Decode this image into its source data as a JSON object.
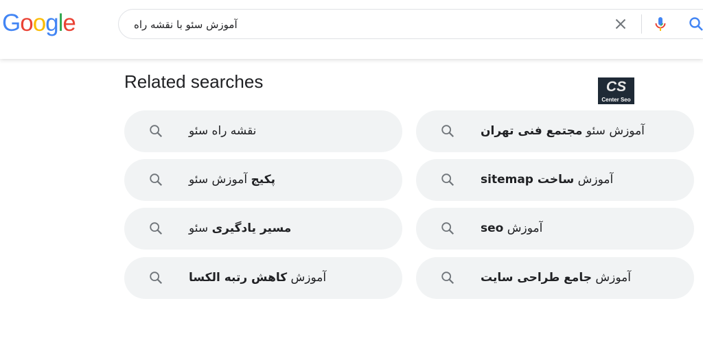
{
  "logo": {
    "letters": [
      "G",
      "o",
      "o",
      "g",
      "l",
      "e"
    ],
    "colors": [
      "#4285f4",
      "#ea4335",
      "#fbbc05",
      "#4285f4",
      "#34a853",
      "#ea4335"
    ]
  },
  "search": {
    "query": "آموزش سئو با نقشه راه"
  },
  "related": {
    "title": "Related searches",
    "items": [
      {
        "regular": "نقشه راه سئو",
        "bold": ""
      },
      {
        "regular": "آموزش سئو ",
        "bold": "مجتمع فنی تهران"
      },
      {
        "regular": " آموزش سئو",
        "bold": "پکیج"
      },
      {
        "regular": "آموزش ",
        "bold": "ساخت sitemap"
      },
      {
        "regular": " سئو",
        "bold": "مسیر یادگیری"
      },
      {
        "regular": "آموزش ",
        "bold": "seo"
      },
      {
        "regular": "آموزش ",
        "bold": "کاهش رتبه الکسا"
      },
      {
        "regular": "آموزش ",
        "bold": "جامع طراحی سایت"
      }
    ]
  },
  "watermark": {
    "mark": "CS",
    "text": "Center Seo"
  },
  "colors": {
    "chip_bg": "#f1f3f4",
    "icon_gray": "#70757a",
    "blue": "#4285f4"
  }
}
